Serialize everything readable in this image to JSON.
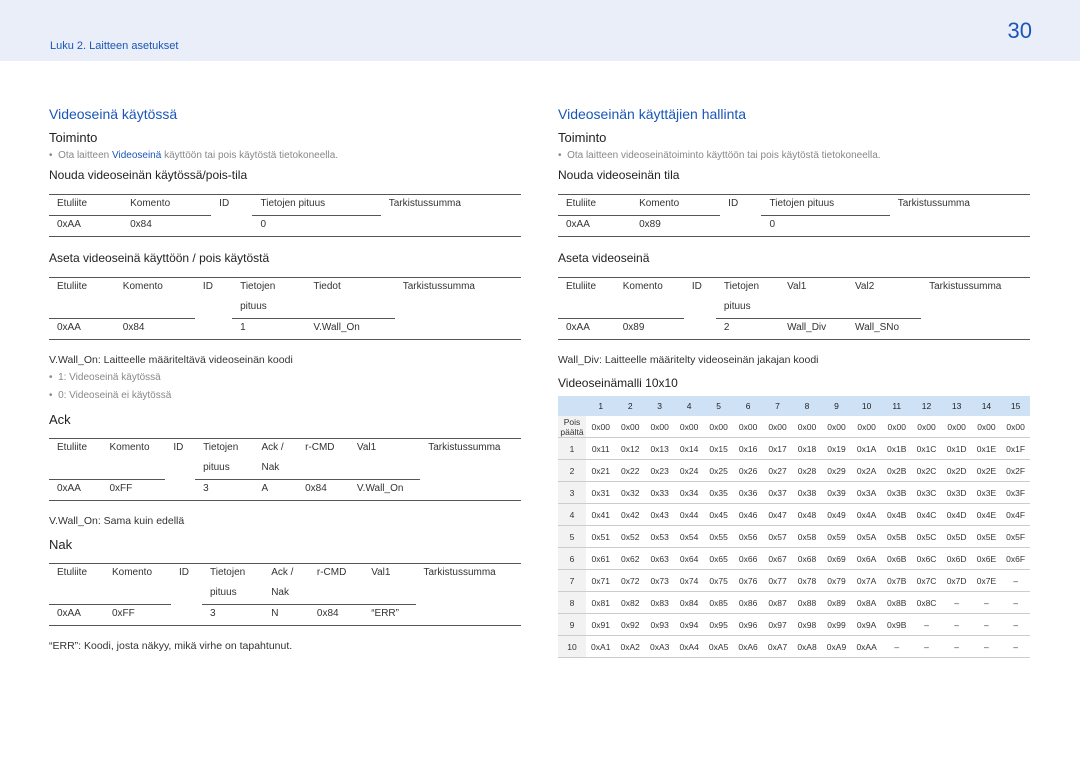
{
  "header": {
    "chapter": "Luku 2. Laitteen asetukset",
    "page": "30"
  },
  "left": {
    "title": "Videoseinä käytössä",
    "toiminto": "Toiminto",
    "bullet_pre": "Ota laitteen ",
    "bullet_hl": "Videoseinä",
    "bullet_post": " käyttöön tai pois käytöstä tietokoneella.",
    "s1": "Nouda videoseinän käytössä/pois-tila",
    "t1": {
      "h": [
        "Etuliite",
        "Komento",
        "ID",
        "Tietojen pituus",
        "Tarkistussumma"
      ],
      "r": [
        "0xAA",
        "0x84",
        "",
        "0",
        ""
      ]
    },
    "s2": "Aseta videoseinä käyttöön / pois käytöstä",
    "t2": {
      "h": [
        "Etuliite",
        "Komento",
        "ID",
        "Tietojen",
        "Tiedot",
        "Tarkistussumma"
      ],
      "h2": "pituus",
      "r": [
        "0xAA",
        "0x84",
        "",
        "1",
        "V.Wall_On",
        ""
      ]
    },
    "note1": "V.Wall_On: Laitteelle määriteltävä videoseinän koodi",
    "b1": "1: Videoseinä käytössä",
    "b2": "0: Videoseinä ei käytössä",
    "ack": "Ack",
    "t3": {
      "h": [
        "Etuliite",
        "Komento",
        "ID",
        "Tietojen",
        "Ack /",
        "r-CMD",
        "Val1",
        "Tarkistussumma"
      ],
      "h2a": "pituus",
      "h2b": "Nak",
      "r": [
        "0xAA",
        "0xFF",
        "",
        "3",
        "A",
        "0x84",
        "V.Wall_On",
        ""
      ]
    },
    "note2": "V.Wall_On: Sama kuin edellä",
    "nak": "Nak",
    "t4": {
      "h": [
        "Etuliite",
        "Komento",
        "ID",
        "Tietojen",
        "Ack /",
        "r-CMD",
        "Val1",
        "Tarkistussumma"
      ],
      "h2a": "pituus",
      "h2b": "Nak",
      "r": [
        "0xAA",
        "0xFF",
        "",
        "3",
        "N",
        "0x84",
        "“ERR”",
        ""
      ]
    },
    "note3": "“ERR”: Koodi, josta näkyy, mikä virhe on tapahtunut."
  },
  "right": {
    "title": "Videoseinän käyttäjien hallinta",
    "toiminto": "Toiminto",
    "bullet": "Ota laitteen videoseinätoiminto käyttöön tai pois käytöstä tietokoneella.",
    "s1": "Nouda videoseinän tila",
    "t1": {
      "h": [
        "Etuliite",
        "Komento",
        "ID",
        "Tietojen pituus",
        "Tarkistussumma"
      ],
      "r": [
        "0xAA",
        "0x89",
        "",
        "0",
        ""
      ]
    },
    "s2": "Aseta videoseinä",
    "t2": {
      "h": [
        "Etuliite",
        "Komento",
        "ID",
        "Tietojen",
        "Val1",
        "Val2",
        "Tarkistussumma"
      ],
      "h2": "pituus",
      "r": [
        "0xAA",
        "0x89",
        "",
        "2",
        "Wall_Div",
        "Wall_SNo",
        ""
      ]
    },
    "note1": "Wall_Div: Laitteelle määritelty videoseinän jakajan koodi",
    "s3": "Videoseinämalli 10x10",
    "grid_cols": [
      "1",
      "2",
      "3",
      "4",
      "5",
      "6",
      "7",
      "8",
      "9",
      "10",
      "11",
      "12",
      "13",
      "14",
      "15"
    ],
    "grid_rows": [
      {
        "h": "Pois päältä",
        "v": [
          "0x00",
          "0x00",
          "0x00",
          "0x00",
          "0x00",
          "0x00",
          "0x00",
          "0x00",
          "0x00",
          "0x00",
          "0x00",
          "0x00",
          "0x00",
          "0x00",
          "0x00"
        ]
      },
      {
        "h": "1",
        "v": [
          "0x11",
          "0x12",
          "0x13",
          "0x14",
          "0x15",
          "0x16",
          "0x17",
          "0x18",
          "0x19",
          "0x1A",
          "0x1B",
          "0x1C",
          "0x1D",
          "0x1E",
          "0x1F"
        ]
      },
      {
        "h": "2",
        "v": [
          "0x21",
          "0x22",
          "0x23",
          "0x24",
          "0x25",
          "0x26",
          "0x27",
          "0x28",
          "0x29",
          "0x2A",
          "0x2B",
          "0x2C",
          "0x2D",
          "0x2E",
          "0x2F"
        ]
      },
      {
        "h": "3",
        "v": [
          "0x31",
          "0x32",
          "0x33",
          "0x34",
          "0x35",
          "0x36",
          "0x37",
          "0x38",
          "0x39",
          "0x3A",
          "0x3B",
          "0x3C",
          "0x3D",
          "0x3E",
          "0x3F"
        ]
      },
      {
        "h": "4",
        "v": [
          "0x41",
          "0x42",
          "0x43",
          "0x44",
          "0x45",
          "0x46",
          "0x47",
          "0x48",
          "0x49",
          "0x4A",
          "0x4B",
          "0x4C",
          "0x4D",
          "0x4E",
          "0x4F"
        ]
      },
      {
        "h": "5",
        "v": [
          "0x51",
          "0x52",
          "0x53",
          "0x54",
          "0x55",
          "0x56",
          "0x57",
          "0x58",
          "0x59",
          "0x5A",
          "0x5B",
          "0x5C",
          "0x5D",
          "0x5E",
          "0x5F"
        ]
      },
      {
        "h": "6",
        "v": [
          "0x61",
          "0x62",
          "0x63",
          "0x64",
          "0x65",
          "0x66",
          "0x67",
          "0x68",
          "0x69",
          "0x6A",
          "0x6B",
          "0x6C",
          "0x6D",
          "0x6E",
          "0x6F"
        ]
      },
      {
        "h": "7",
        "v": [
          "0x71",
          "0x72",
          "0x73",
          "0x74",
          "0x75",
          "0x76",
          "0x77",
          "0x78",
          "0x79",
          "0x7A",
          "0x7B",
          "0x7C",
          "0x7D",
          "0x7E",
          "–"
        ]
      },
      {
        "h": "8",
        "v": [
          "0x81",
          "0x82",
          "0x83",
          "0x84",
          "0x85",
          "0x86",
          "0x87",
          "0x88",
          "0x89",
          "0x8A",
          "0x8B",
          "0x8C",
          "–",
          "–",
          "–"
        ]
      },
      {
        "h": "9",
        "v": [
          "0x91",
          "0x92",
          "0x93",
          "0x94",
          "0x95",
          "0x96",
          "0x97",
          "0x98",
          "0x99",
          "0x9A",
          "0x9B",
          "–",
          "–",
          "–",
          "–"
        ]
      },
      {
        "h": "10",
        "v": [
          "0xA1",
          "0xA2",
          "0xA3",
          "0xA4",
          "0xA5",
          "0xA6",
          "0xA7",
          "0xA8",
          "0xA9",
          "0xAA",
          "–",
          "–",
          "–",
          "–",
          "–"
        ]
      }
    ]
  }
}
